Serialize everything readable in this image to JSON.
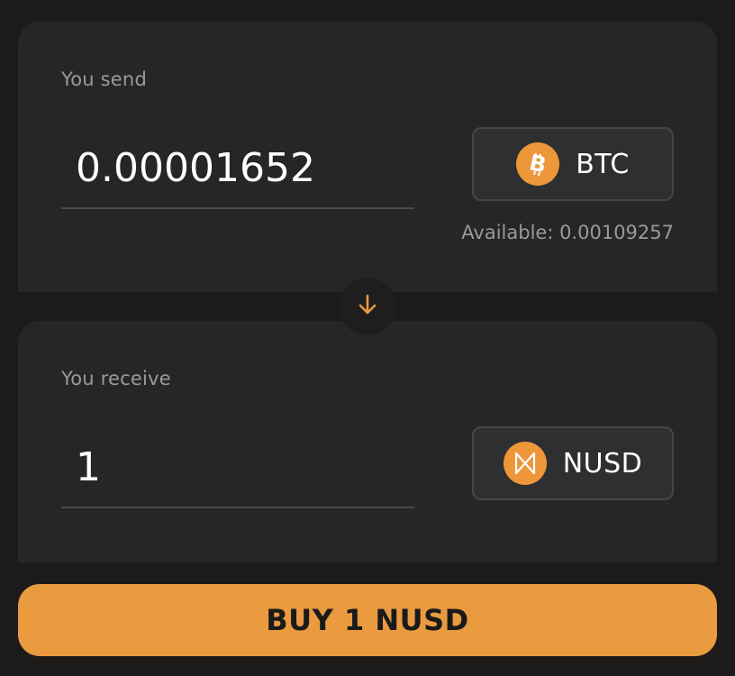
{
  "send": {
    "label": "You send",
    "amount": "0.00001652",
    "token": {
      "symbol": "BTC",
      "icon": "bitcoin-icon",
      "icon_color": "#ed963a"
    },
    "available": "Available: 0.00109257"
  },
  "swap": {
    "icon": "arrow-down-icon",
    "color": "#ea9a3f"
  },
  "receive": {
    "label": "You receive",
    "amount": "1",
    "token": {
      "symbol": "NUSD",
      "icon": "nusd-icon",
      "icon_color": "#ed963a"
    }
  },
  "action": {
    "buy_label": "BUY 1 NUSD",
    "color": "#ea9a3f"
  }
}
